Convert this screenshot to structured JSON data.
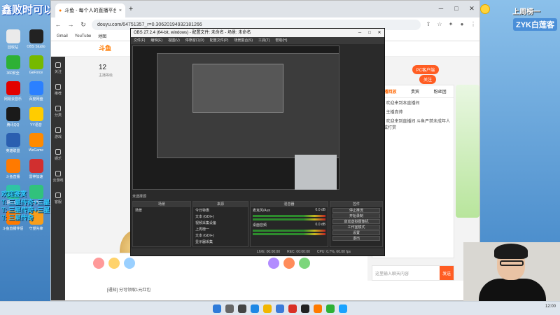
{
  "overlay": {
    "title": "鑫败时可以点点关注",
    "side_lines": [
      "欢迎鉴赏",
      "T: 三星传奇+三星鉴赏",
      "T: 三星传奇+三星鉴赏",
      "T: 三星传奇"
    ]
  },
  "desktop_icons": [
    {
      "label": "回收站",
      "color": "#eaeaea"
    },
    {
      "label": "OBS Studio",
      "color": "#222222"
    },
    {
      "label": "360安全",
      "color": "#2eb135"
    },
    {
      "label": "GeForce",
      "color": "#76b900"
    },
    {
      "label": "网易云音乐",
      "color": "#e20000"
    },
    {
      "label": "百度网盘",
      "color": "#2b80ff"
    },
    {
      "label": "腾讯QQ",
      "color": "#1a1a1a"
    },
    {
      "label": "YY语音",
      "color": "#ffcc00"
    },
    {
      "label": "英雄联盟",
      "color": "#2a5fb0"
    },
    {
      "label": "WeGame",
      "color": "#ff8a00"
    },
    {
      "label": "斗鱼直播",
      "color": "#ff7a00"
    },
    {
      "label": "雷神加速",
      "color": "#d12f2f"
    },
    {
      "label": "网易UU",
      "color": "#2fc4a4"
    },
    {
      "label": "QQ音乐",
      "color": "#31c27c"
    },
    {
      "label": "斗鱼直播伴侣",
      "color": "#ff7a00"
    },
    {
      "label": "守望先锋",
      "color": "#f99e1a"
    }
  ],
  "browser": {
    "tab_label": "斗鱼 - 每个人的直播平台",
    "url": "douyu.com/64751357_r=0.30620194932181266",
    "bookmarks": [
      "Gmail",
      "YouTube",
      "地图"
    ]
  },
  "douyu": {
    "logo": "斗鱼",
    "room_number": "12",
    "room_sub": "主播等级",
    "rail": [
      "关注",
      "推荐",
      "分类",
      "游戏",
      "娱乐",
      "云游戏",
      "客服"
    ],
    "pc_client": "PC客户端",
    "follow": "关注",
    "panel_tabs": [
      "直播回放",
      "贵宾",
      "粉丝团"
    ],
    "chat": [
      {
        "user": "系统",
        "text": "欢迎来到本直播间"
      },
      {
        "user": "弹幕",
        "text": "主播真帅"
      },
      {
        "user": "公告",
        "text": "欢迎来到直播间 斗鱼严禁未成年人直播或打赏"
      }
    ],
    "chat_placeholder": "这里输入聊天内容",
    "send": "发送",
    "notice": "[通知] 分可领取1元红包"
  },
  "obs": {
    "title": "OBS 27.2.4 (64-bit, windows) - 配置文件: 未命名 - 场景: 未命名",
    "menu": [
      "文件(F)",
      "编辑(E)",
      "视图(V)",
      "停靠窗口(D)",
      "配置文件(P)",
      "场景集合(S)",
      "工具(T)",
      "帮助(H)"
    ],
    "scene_label": "未选择源",
    "docks": {
      "scenes": {
        "title": "场景",
        "items": [
          "场景"
        ]
      },
      "sources": {
        "title": "来源",
        "items": [
          "今日特惠",
          "文本 (GDI+)",
          "视频采集设备",
          "上周榜一",
          "文本 (GDI+)",
          "显示器采集"
        ]
      },
      "mixer": {
        "title": "混音器",
        "items": [
          "麦克风/Aux",
          "桌面音频"
        ],
        "levels": [
          "0.0 dB",
          "0.0 dB"
        ]
      },
      "controls": {
        "title": "控件",
        "buttons": [
          "停止推流",
          "开始录制",
          "启动虚拟摄像机",
          "工作室模式",
          "设置",
          "退出"
        ]
      }
    },
    "status": [
      "LIVE: 00:00:00",
      "REC: 00:00:00",
      "CPU: 0.7%, 60.00 fps"
    ]
  },
  "badge": {
    "title": "上周榜一",
    "name": "ZYK白莲客"
  },
  "taskbar": {
    "time": "12:00"
  }
}
